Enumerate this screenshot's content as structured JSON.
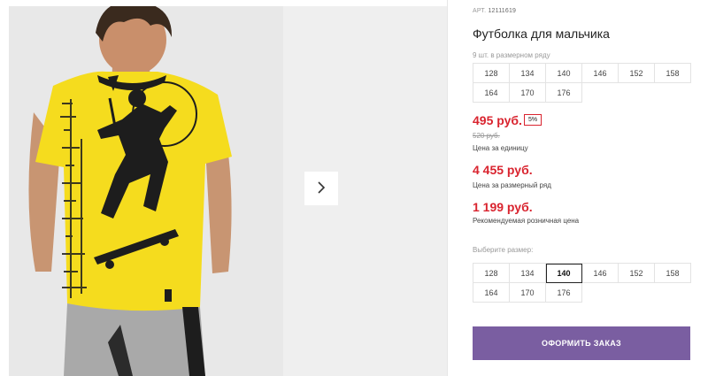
{
  "product": {
    "sku_label": "АРТ.",
    "sku": "12111619",
    "title": "Футболка для мальчика",
    "range_note": "9 шт. в размерном ряду",
    "range_sizes": [
      "128",
      "134",
      "140",
      "146",
      "152",
      "158",
      "164",
      "170",
      "176"
    ]
  },
  "pricing": {
    "unit_price": "495 руб.",
    "discount": "5%",
    "old_price": "520 руб.",
    "unit_caption": "Цена за единицу",
    "range_price": "4 455 руб.",
    "range_caption": "Цена за размерный ряд",
    "retail_price": "1 199 руб.",
    "retail_caption": "Рекомендуемая розничная цена"
  },
  "size_select": {
    "label": "Выберите размер:",
    "options": [
      "128",
      "134",
      "140",
      "146",
      "152",
      "158",
      "164",
      "170",
      "176"
    ],
    "selected": "140"
  },
  "actions": {
    "order_label": "ОФОРМИТЬ ЗАКАЗ"
  },
  "colors": {
    "accent_red": "#d9242f",
    "button_purple": "#7a5ea1",
    "shirt_yellow": "#f5dc1e"
  },
  "icons": {
    "next": "chevron-right-icon"
  }
}
